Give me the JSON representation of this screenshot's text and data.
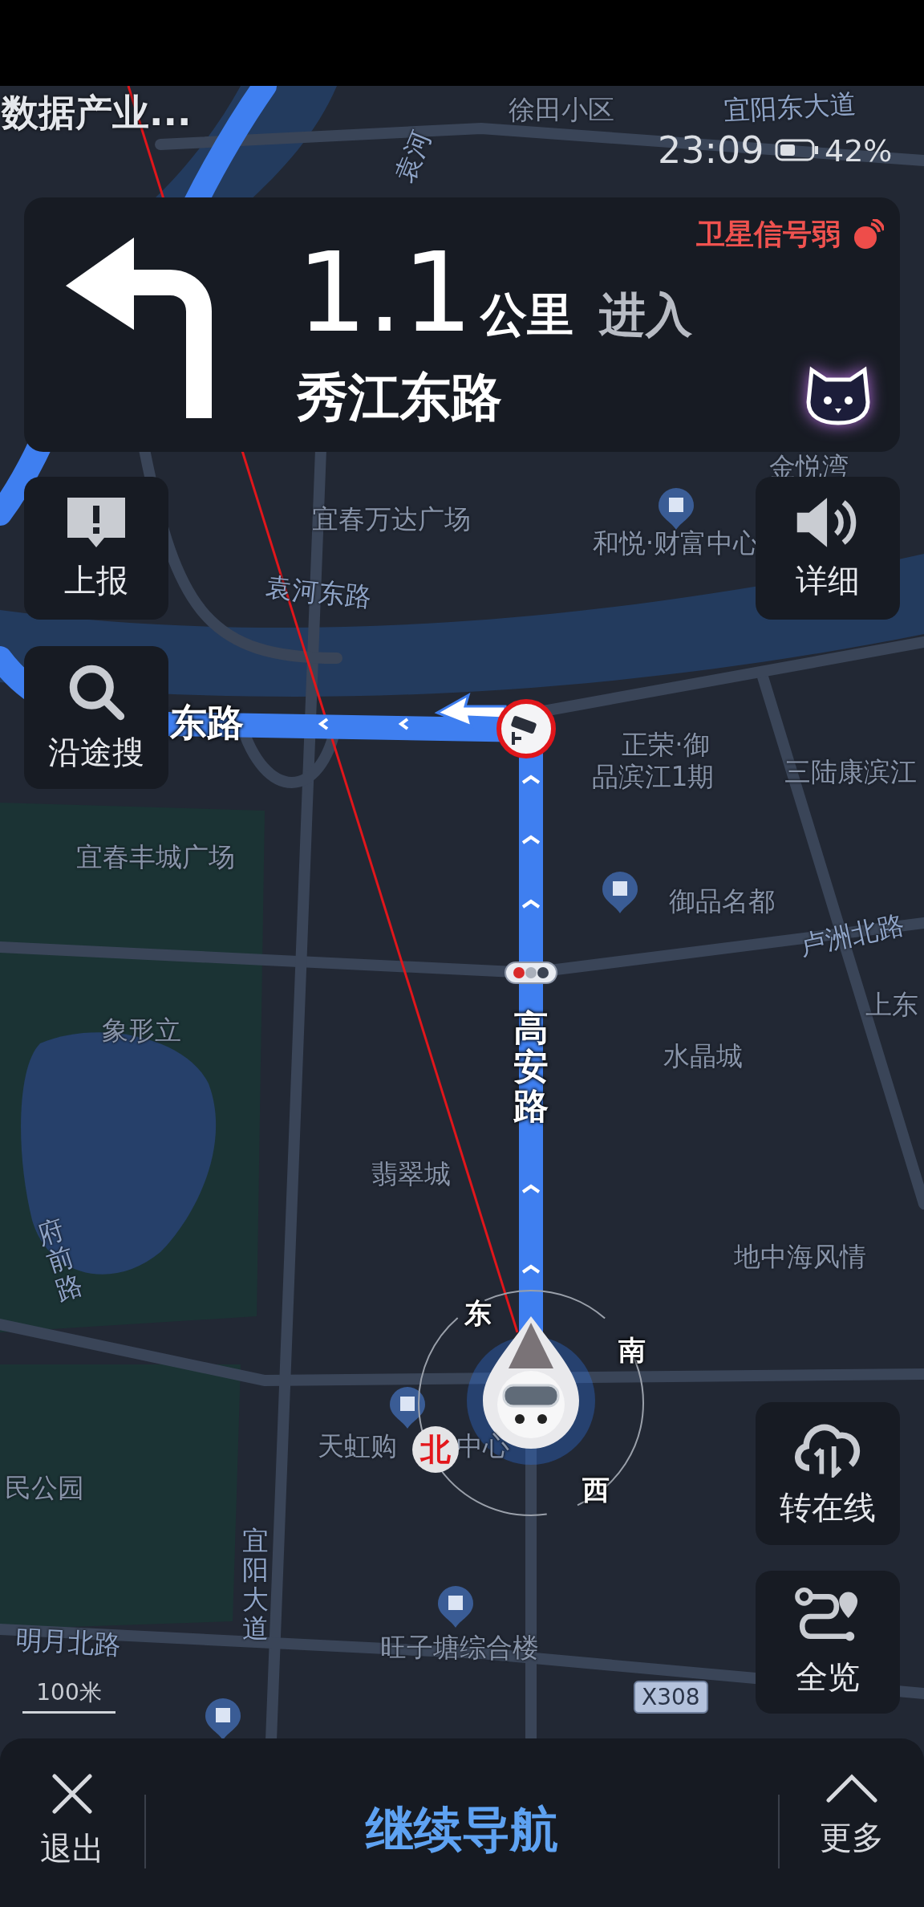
{
  "status_bar": {
    "time": "23:09",
    "battery": "42%"
  },
  "map_title": "数据产业...",
  "guidance": {
    "distance": "1.1",
    "unit": "公里",
    "action": "进入",
    "road": "秀江东路",
    "gps_warning": "卫星信号弱"
  },
  "side_buttons": [
    {
      "label": "上报",
      "kind": "report"
    },
    {
      "label": "沿途搜",
      "kind": "search"
    },
    {
      "label": "详细",
      "kind": "sound"
    },
    {
      "label": "转在线",
      "kind": "online"
    },
    {
      "label": "全览",
      "kind": "overview"
    }
  ],
  "map_labels": [
    {
      "text": "徐田小区",
      "kind": "place"
    },
    {
      "text": "宜阳东大道",
      "kind": "road"
    },
    {
      "text": "袁河",
      "kind": "road"
    },
    {
      "text": "金悦湾",
      "kind": "place"
    },
    {
      "text": "宜春万达广场",
      "kind": "place"
    },
    {
      "text": "和悦·财富中心",
      "kind": "place"
    },
    {
      "text": "袁河东路",
      "kind": "road"
    },
    {
      "text": "东路",
      "kind": "route"
    },
    {
      "text": "正荣·御",
      "kind": "place"
    },
    {
      "text": "品滨江1期",
      "kind": "place"
    },
    {
      "text": "三陆康滨江",
      "kind": "place"
    },
    {
      "text": "宜春丰城广场",
      "kind": "place"
    },
    {
      "text": "御品名都",
      "kind": "place"
    },
    {
      "text": "卢洲北路",
      "kind": "road"
    },
    {
      "text": "上东",
      "kind": "place"
    },
    {
      "text": "象形立",
      "kind": "place"
    },
    {
      "text": "高安路",
      "kind": "route"
    },
    {
      "text": "水晶城",
      "kind": "place"
    },
    {
      "text": "翡翠城",
      "kind": "place"
    },
    {
      "text": "地中海风情",
      "kind": "place"
    },
    {
      "text": "府前路",
      "kind": "road"
    },
    {
      "text": "天虹购",
      "kind": "place"
    },
    {
      "text": "中心",
      "kind": "place"
    },
    {
      "text": "民公园",
      "kind": "place"
    },
    {
      "text": "宜阳大道",
      "kind": "road"
    },
    {
      "text": "明月北路",
      "kind": "road"
    },
    {
      "text": "旺子塘综合楼",
      "kind": "place"
    }
  ],
  "compass": {
    "east": "东",
    "south": "南",
    "west": "西",
    "north": "北"
  },
  "scale": "100米",
  "road_badge": "X308",
  "bottom_bar": {
    "exit": "退出",
    "primary": "继续导航",
    "more": "更多"
  }
}
